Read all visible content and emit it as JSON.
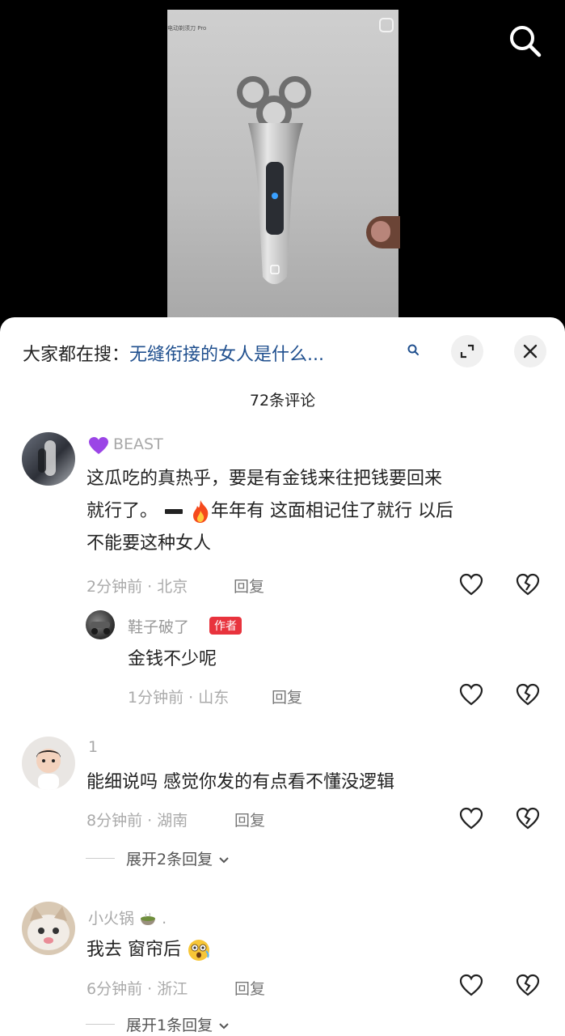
{
  "video": {
    "caption": "电动剃须刀 Pro"
  },
  "search_bar": {
    "prefix": "大家都在搜：",
    "term": "无缝衔接的女人是什么...",
    "icon": "search-icon"
  },
  "comment_count": "72条评论",
  "comments": [
    {
      "name": "BEAST",
      "name_prefix_icon": "purple-heart-icon",
      "lines": [
        "这瓜吃的真热乎，要是有金钱来往把钱要回来",
        "就行了。",
        "年年有 这面相记住了就行 以后",
        "不能要这种女人"
      ],
      "inline_icons": [
        "dash-icon",
        "fire-icon"
      ],
      "meta": "2分钟前 · 北京",
      "reply_label": "回复",
      "replies": [
        {
          "name": "鞋子破了",
          "badge": "作者",
          "text": "金钱不少呢",
          "meta": "1分钟前 · 山东",
          "reply_label": "回复"
        }
      ]
    },
    {
      "name": "1",
      "text": "能细说吗 感觉你发的有点看不懂没逻辑",
      "meta": "8分钟前 · 湖南",
      "reply_label": "回复",
      "expand_label": "展开2条回复"
    },
    {
      "name": "小火锅",
      "name_suffix": ".",
      "text": "我去 窗帘后",
      "meta": "6分钟前 · 浙江",
      "reply_label": "回复",
      "expand_label": "展开1条回复"
    }
  ],
  "colors": {
    "link": "#1f4f8e",
    "author_badge": "#e8333d",
    "muted": "#a8a8a8"
  }
}
